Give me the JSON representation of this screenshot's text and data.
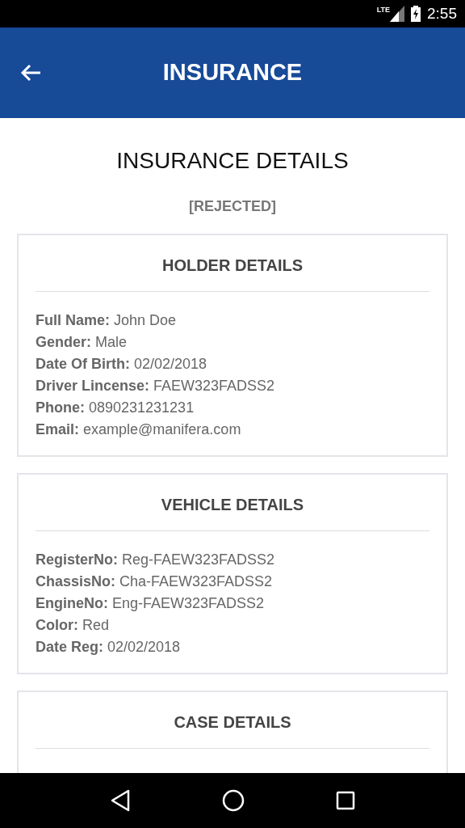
{
  "status_bar": {
    "network": "LTE",
    "time": "2:55"
  },
  "app_bar": {
    "title": "INSURANCE"
  },
  "page_title": "INSURANCE DETAILS",
  "status_text": "[REJECTED]",
  "sections": [
    {
      "title": "HOLDER DETAILS",
      "lines": [
        "**Full Name:** John Doe",
        "**Gender:** Male",
        "**Date Of Birth:** 02/02/2018",
        "**Driver Lincense:** FAEW323FADSS2",
        "**Phone:** 0890231231231",
        "**Email:** example@manifera.com"
      ]
    },
    {
      "title": "VEHICLE DETAILS",
      "lines": [
        "**RegisterNo:** Reg-FAEW323FADSS2",
        "**ChassisNo:** Cha-FAEW323FADSS2",
        "**EngineNo:** Eng-FAEW323FADSS2",
        "**Color:** Red",
        "**Date Reg:** 02/02/2018"
      ]
    },
    {
      "title": "CASE DETAILS"
    }
  ]
}
